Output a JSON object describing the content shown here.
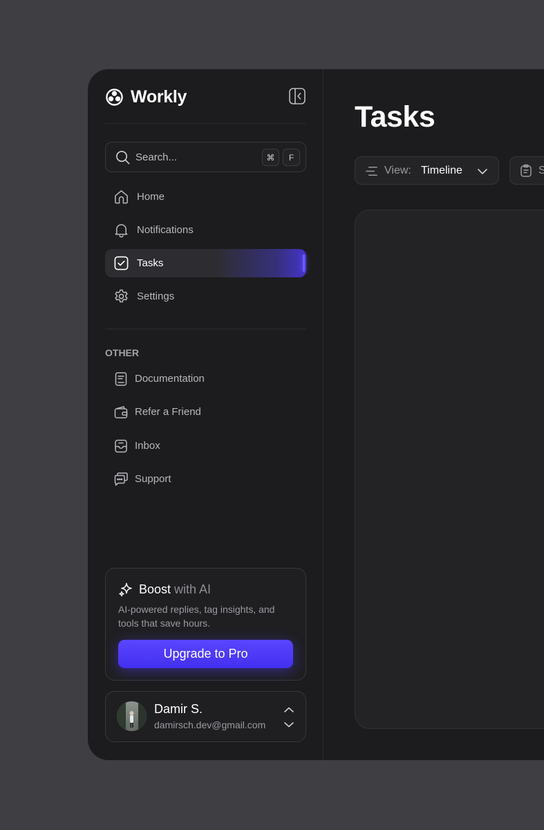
{
  "app": {
    "name": "Workly"
  },
  "search": {
    "placeholder": "Search...",
    "shortcut_keys": [
      "⌘",
      "F"
    ]
  },
  "nav": {
    "items": [
      {
        "label": "Home",
        "icon": "home-icon",
        "active": false
      },
      {
        "label": "Notifications",
        "icon": "bell-icon",
        "active": false
      },
      {
        "label": "Tasks",
        "icon": "check-square-icon",
        "active": true
      },
      {
        "label": "Settings",
        "icon": "gear-icon",
        "active": false
      }
    ]
  },
  "other": {
    "section_label": "OTHER",
    "items": [
      {
        "label": "Documentation",
        "icon": "document-icon"
      },
      {
        "label": "Refer a Friend",
        "icon": "wallet-icon"
      },
      {
        "label": "Inbox",
        "icon": "inbox-icon"
      },
      {
        "label": "Support",
        "icon": "chat-icon"
      }
    ]
  },
  "boost": {
    "title_main": "Boost",
    "title_rest": " with AI",
    "description": "AI-powered replies, tag insights, and tools that save hours.",
    "button_label": "Upgrade to Pro"
  },
  "profile": {
    "name": "Damir S.",
    "email": "damirsch.dev@gmail.com"
  },
  "main": {
    "title": "Tasks",
    "view_prefix": "View:",
    "view_value": "Timeline",
    "second_control_label": "S"
  },
  "colors": {
    "background": "#3f3e43",
    "surface": "#1c1c1e",
    "accent": "#4f3cf7"
  }
}
